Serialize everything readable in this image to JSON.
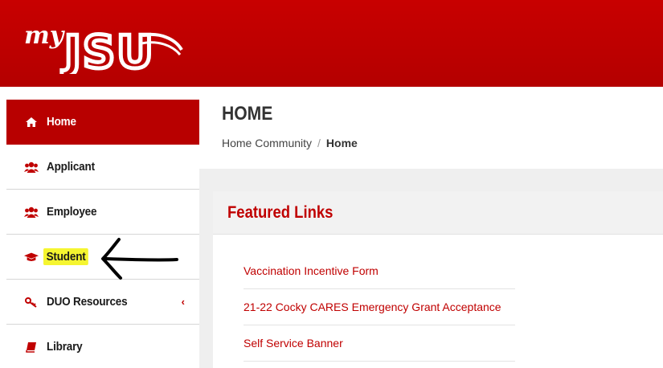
{
  "header": {
    "logo_text": "myJSU",
    "brand_color": "#c80000"
  },
  "sidebar": {
    "items": [
      {
        "label": "Home",
        "icon": "home-icon",
        "active": true
      },
      {
        "label": "Applicant",
        "icon": "users-icon"
      },
      {
        "label": "Employee",
        "icon": "users-icon"
      },
      {
        "label": "Student",
        "icon": "graduation-cap-icon",
        "highlighted": true
      },
      {
        "label": "DUO Resources",
        "icon": "key-icon",
        "has_submenu": true
      },
      {
        "label": "Library",
        "icon": "book-icon"
      }
    ],
    "chevron": "‹"
  },
  "page": {
    "title": "HOME",
    "breadcrumb": {
      "parent": "Home Community",
      "separator": "/",
      "current": "Home"
    }
  },
  "featured": {
    "title": "Featured Links",
    "links": [
      "Vaccination Incentive Form",
      "21-22 Cocky CARES Emergency Grant Acceptance",
      "Self Service Banner"
    ]
  },
  "annotation": {
    "type": "arrow",
    "points_to": "Student"
  }
}
